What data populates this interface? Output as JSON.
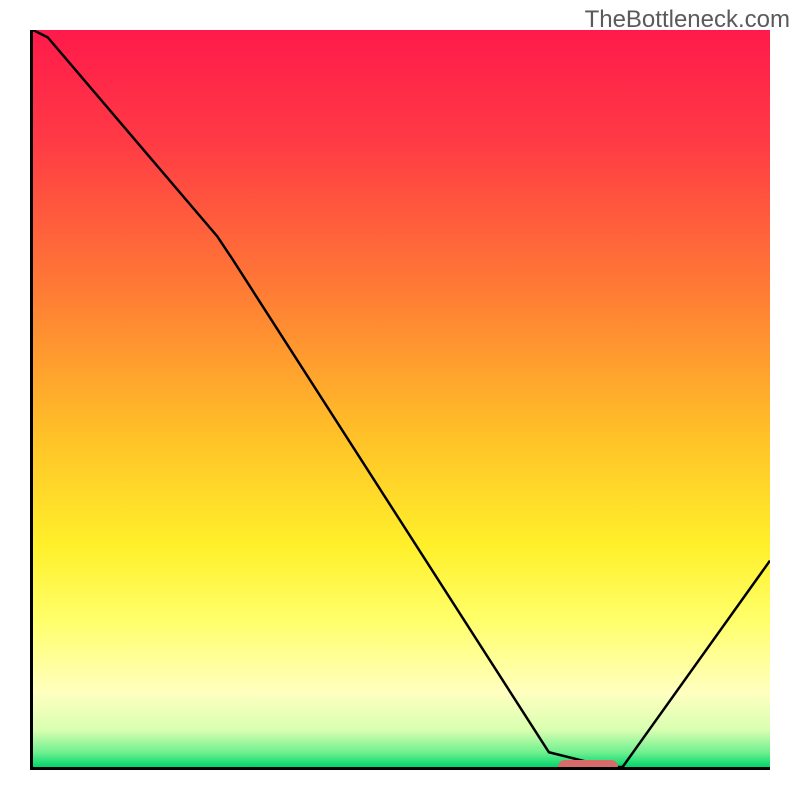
{
  "watermark": "TheBottleneck.com",
  "chart_data": {
    "type": "line",
    "title": "",
    "xlabel": "",
    "ylabel": "",
    "xlim": [
      0,
      100
    ],
    "ylim": [
      0,
      100
    ],
    "x": [
      0,
      2,
      25,
      27,
      70,
      78,
      80,
      100
    ],
    "values": [
      100,
      99,
      72,
      69,
      2,
      0,
      0,
      28
    ],
    "marker": {
      "x_start": 71,
      "x_end": 79,
      "y": 0
    },
    "gradient_stops": [
      {
        "pos": 0,
        "color": "#ff1a4b"
      },
      {
        "pos": 15,
        "color": "#ff3a45"
      },
      {
        "pos": 35,
        "color": "#ff7a35"
      },
      {
        "pos": 55,
        "color": "#ffc128"
      },
      {
        "pos": 70,
        "color": "#fff02a"
      },
      {
        "pos": 80,
        "color": "#ffff6a"
      },
      {
        "pos": 90,
        "color": "#ffffc0"
      },
      {
        "pos": 95,
        "color": "#d8ffb0"
      },
      {
        "pos": 98,
        "color": "#70f090"
      },
      {
        "pos": 100,
        "color": "#00d66a"
      }
    ]
  }
}
